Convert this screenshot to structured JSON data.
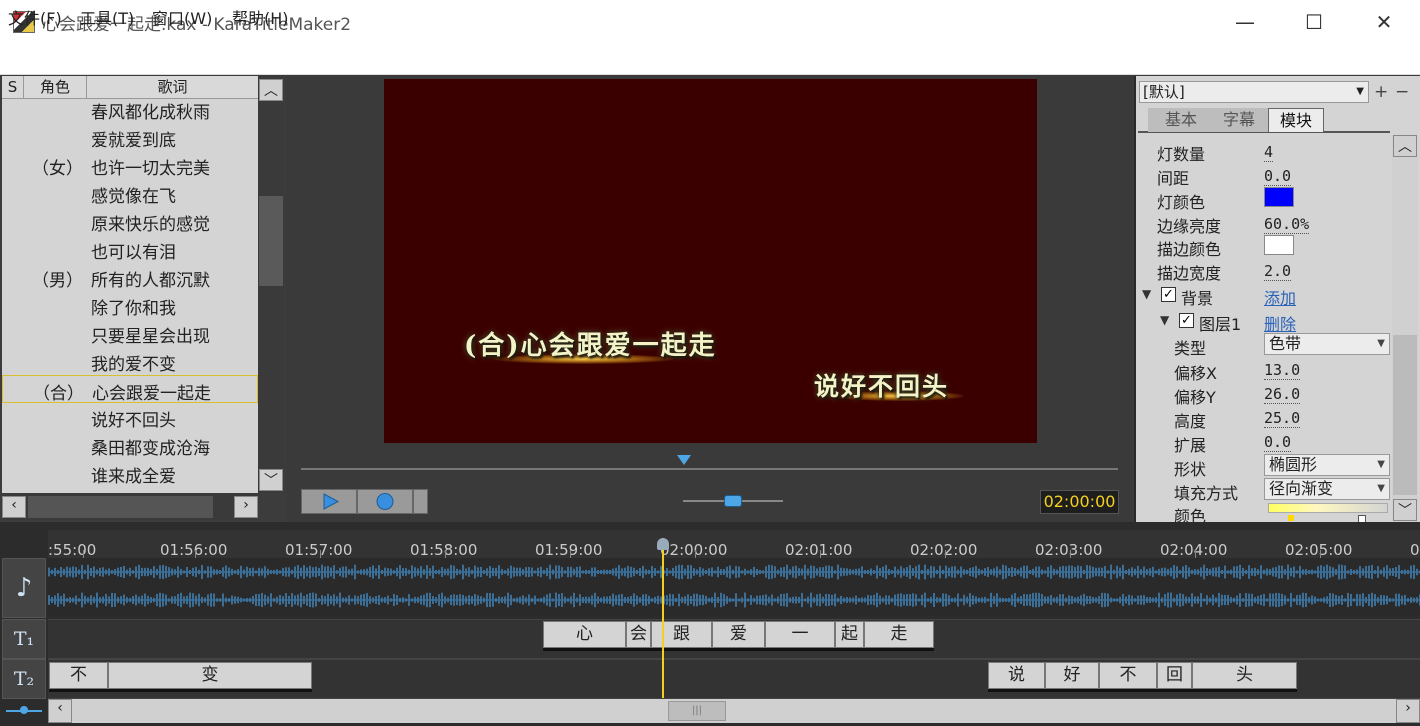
{
  "window": {
    "title": "心会跟爱一起走.kax - KaraTitleMaker2",
    "minimize": "—",
    "maximize": "☐",
    "close": "✕"
  },
  "menu": [
    "文件(F)",
    "工具(T)",
    "窗口(W)",
    "帮助(H)"
  ],
  "lyrics": {
    "headers": {
      "s": "S",
      "role": "角色",
      "lyric": "歌词"
    },
    "rows": [
      {
        "role": "",
        "text": "春风都化成秋雨"
      },
      {
        "role": "",
        "text": "爱就爱到底"
      },
      {
        "role": "（女）",
        "text": "也许一切太完美"
      },
      {
        "role": "",
        "text": "感觉像在飞"
      },
      {
        "role": "",
        "text": "原来快乐的感觉"
      },
      {
        "role": "",
        "text": "也可以有泪"
      },
      {
        "role": "（男）",
        "text": "所有的人都沉默"
      },
      {
        "role": "",
        "text": "除了你和我"
      },
      {
        "role": "",
        "text": "只要星星会出现"
      },
      {
        "role": "",
        "text": "我的爱不变"
      },
      {
        "role": "（合）",
        "text": "心会跟爱一起走"
      },
      {
        "role": "",
        "text": "说好不回头"
      },
      {
        "role": "",
        "text": "桑田都变成沧海"
      },
      {
        "role": "",
        "text": "谁来成全爱"
      }
    ],
    "selected_index": 10
  },
  "preview": {
    "line1": "(合)心会跟爱一起走",
    "line2": "说好不回头",
    "background_color": "#3a0000"
  },
  "transport": {
    "time": "02:00:00",
    "play_icon": "play-icon",
    "record_icon": "record-icon"
  },
  "props": {
    "style_select": "[默认]",
    "tabs": [
      "基本",
      "字幕",
      "模块"
    ],
    "active_tab": "模块",
    "rows": [
      {
        "label": "灯数量",
        "value": "4"
      },
      {
        "label": "间距",
        "value": "0.0"
      },
      {
        "label": "灯颜色",
        "value": ""
      },
      {
        "label": "边缘亮度",
        "value": "60.0%"
      },
      {
        "label": "描边颜色",
        "value": ""
      },
      {
        "label": "描边宽度",
        "value": "2.0"
      }
    ],
    "lamp_color": "#0000ff",
    "stroke_color": "#ffffff",
    "background_label": "背景",
    "add_link": "添加",
    "layer_label": "图层1",
    "delete_link": "删除",
    "layer_rows": [
      {
        "label": "类型",
        "value": "色带",
        "kind": "dropdown"
      },
      {
        "label": "偏移X",
        "value": "13.0",
        "kind": "value"
      },
      {
        "label": "偏移Y",
        "value": "26.0",
        "kind": "value"
      },
      {
        "label": "高度",
        "value": "25.0",
        "kind": "value"
      },
      {
        "label": "扩展",
        "value": "0.0",
        "kind": "value"
      },
      {
        "label": "形状",
        "value": "椭圆形",
        "kind": "dropdown"
      },
      {
        "label": "填充方式",
        "value": "径向渐变",
        "kind": "dropdown"
      },
      {
        "label": "颜色",
        "value": "",
        "kind": "gradient"
      }
    ]
  },
  "timeline": {
    "ticks": [
      ":55:00",
      "01:56:00",
      "01:57:00",
      "01:58:00",
      "01:59:00",
      "02:00:00",
      "02:01:00",
      "02:02:00",
      "02:03:00",
      "02:04:00",
      "02:05:00",
      "0"
    ],
    "track1_cells": [
      "心",
      "会",
      "跟",
      "爱",
      "一",
      "起",
      "走"
    ],
    "track2_left_cells": [
      "不",
      "变"
    ],
    "track2_right_cells": [
      "说",
      "好",
      "不",
      "回",
      "头"
    ],
    "track1_icon": "T₁",
    "track2_icon": "T₂",
    "audio_icon": "♪"
  }
}
